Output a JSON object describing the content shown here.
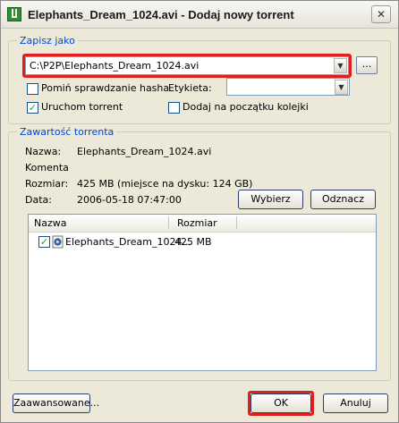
{
  "window": {
    "title": "Elephants_Dream_1024.avi - Dodaj nowy torrent",
    "close_label": "✕"
  },
  "save_as": {
    "legend": "Zapisz jako",
    "path_value": "C:\\P2P\\Elephants_Dream_1024.avi",
    "browse_label": "...",
    "skip_hash_label": "Pomiń sprawdzanie hasha",
    "skip_hash_checked": false,
    "label_label": "Etykieta:",
    "label_value": "",
    "start_torrent_label": "Uruchom torrent",
    "start_torrent_checked": true,
    "add_top_label": "Dodaj na początku kolejki",
    "add_top_checked": false
  },
  "contents": {
    "legend": "Zawartość torrenta",
    "name_key": "Nazwa:",
    "name_value": "Elephants_Dream_1024.avi",
    "comment_key": "Komentarz:",
    "comment_value": "",
    "size_key": "Rozmiar:",
    "size_value": "425 MB (miejsce na dysku: 124 GB)",
    "date_key": "Data:",
    "date_value": "2006-05-18 07:47:00",
    "select_all_label": "Wybierz",
    "deselect_label": "Odznacz",
    "columns": [
      "Nazwa",
      "Rozmiar"
    ],
    "files": [
      {
        "name": "Elephants_Dream_1024...",
        "size": "425 MB",
        "checked": true
      }
    ]
  },
  "footer": {
    "advanced_label": "Zaawansowane...",
    "ok_label": "OK",
    "cancel_label": "Anuluj"
  },
  "highlight_color": "#e0201e",
  "accent_color": "#0046d5"
}
